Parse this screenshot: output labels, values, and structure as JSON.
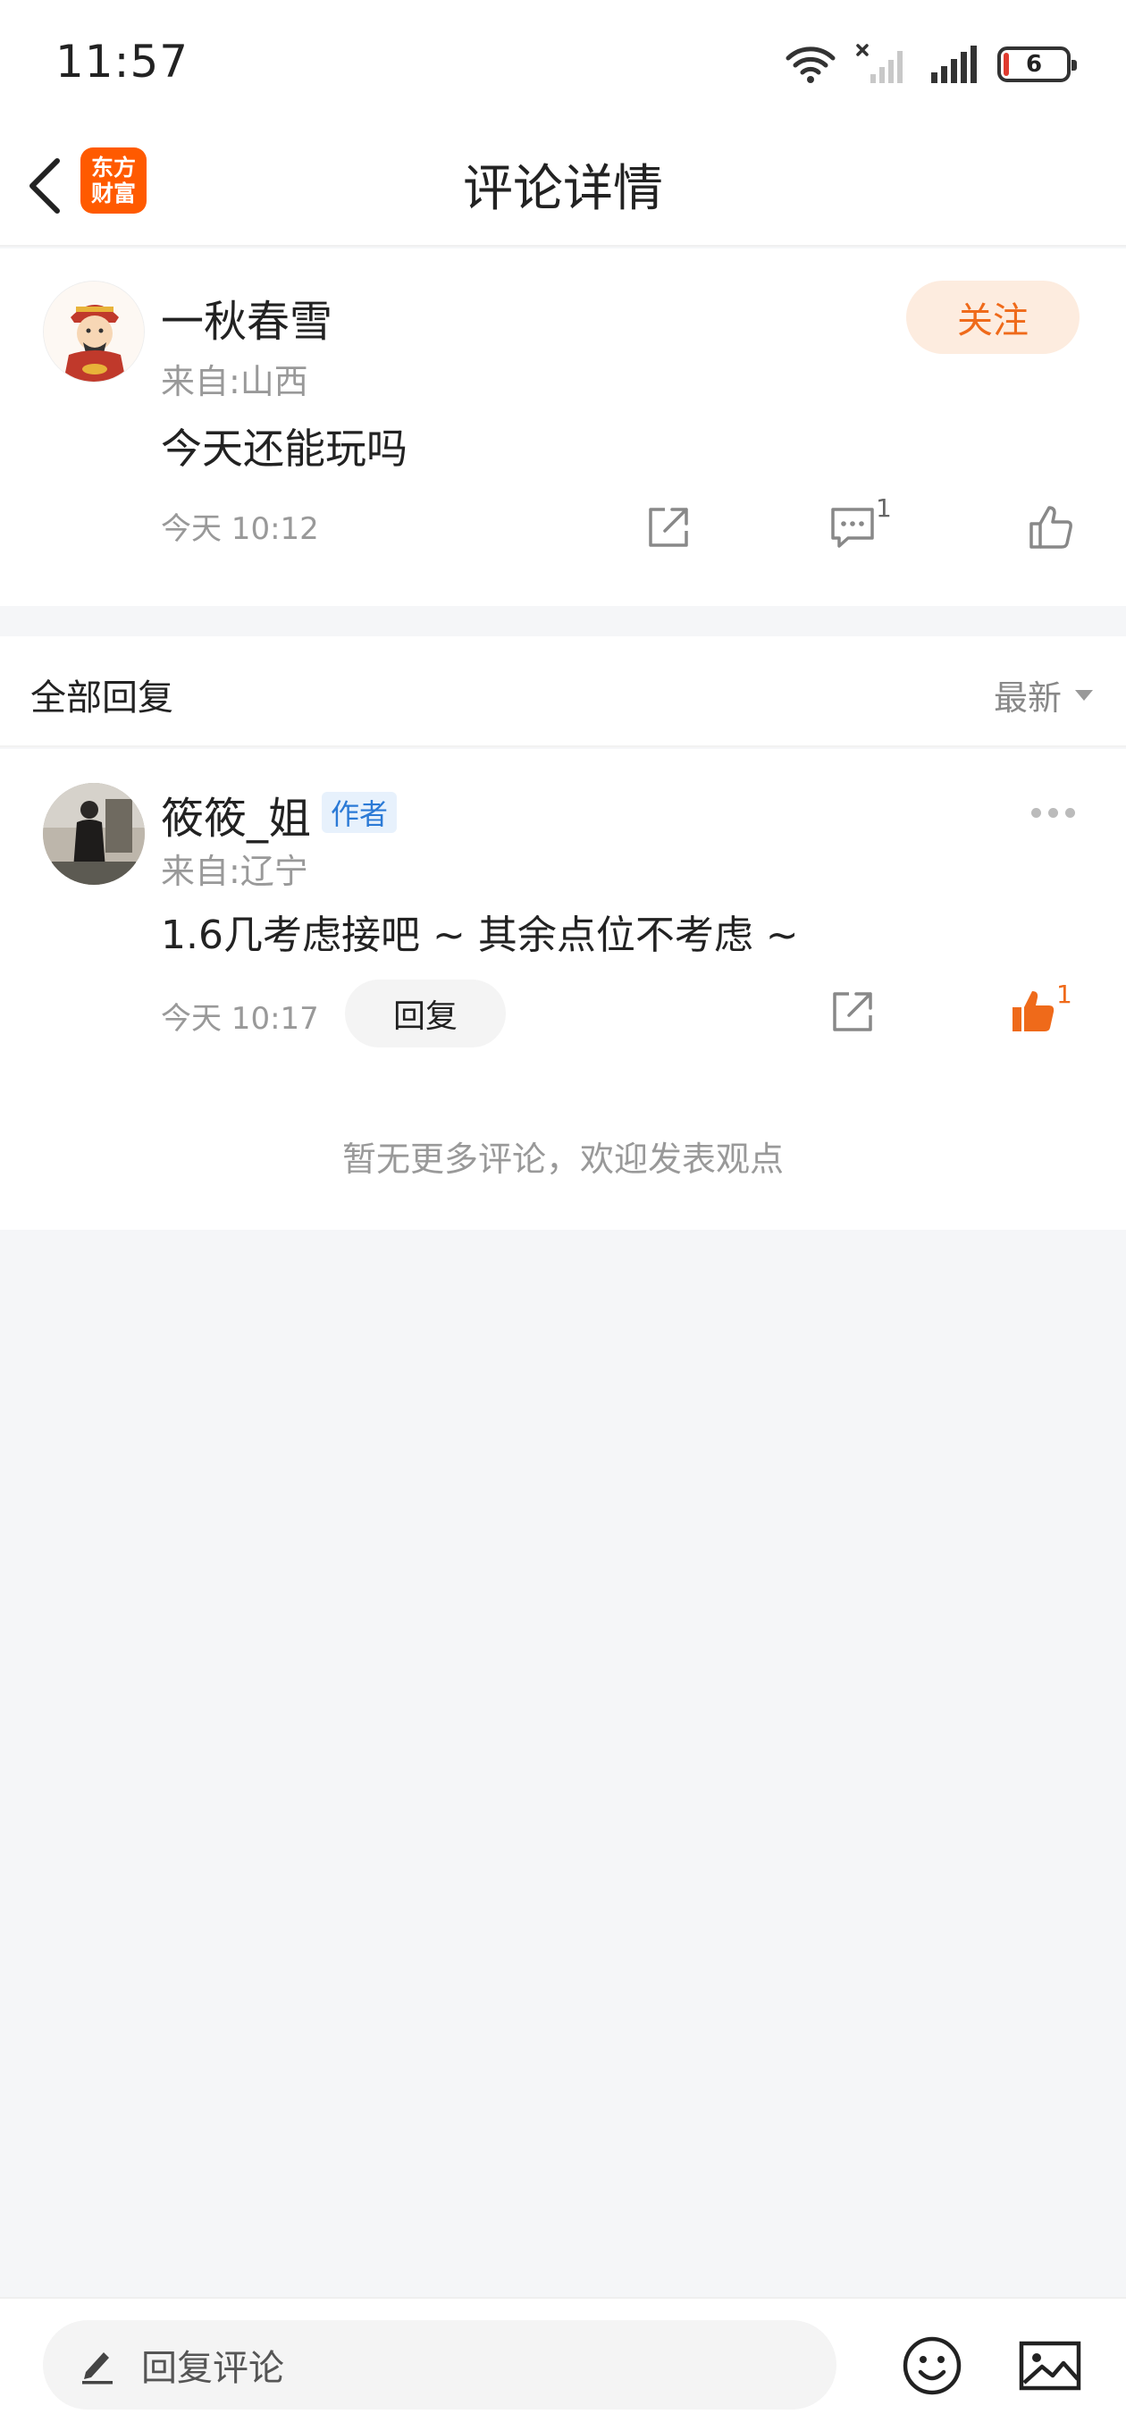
{
  "status_bar": {
    "time": "11:57",
    "battery": "6"
  },
  "nav": {
    "title": "评论详情",
    "logo_line1": "东方",
    "logo_line2": "财富",
    "logo_color": "#ff5a00"
  },
  "main_comment": {
    "author": "一秋春雪",
    "follow_label": "关注",
    "location": "来自:山西",
    "text": "今天还能玩吗",
    "time": "今天 10:12",
    "reply_count": "1",
    "icons": [
      "share-icon",
      "comment-icon",
      "thumbs-up-icon"
    ]
  },
  "replies": {
    "title": "全部回复",
    "sort_label": "最新",
    "items": [
      {
        "author": "筱筱_姐",
        "badge": "作者",
        "location": "来自:辽宁",
        "text": "1.6几考虑接吧 ~ 其余点位不考虑 ~",
        "time": "今天 10:17",
        "reply_label": "回复",
        "like_count": "1",
        "liked": true
      }
    ],
    "no_more_text": "暂无更多评论，欢迎发表观点"
  },
  "bottom_bar": {
    "input_placeholder": "回复评论",
    "icons": [
      "edit-icon",
      "emoji-icon",
      "image-icon"
    ]
  },
  "colors": {
    "accent": "#ef6a1a",
    "follow_bg": "#fdecdf",
    "badge_text": "#2b7ad6",
    "badge_bg": "#e7f1fc",
    "page_bg": "#f5f6f8"
  }
}
